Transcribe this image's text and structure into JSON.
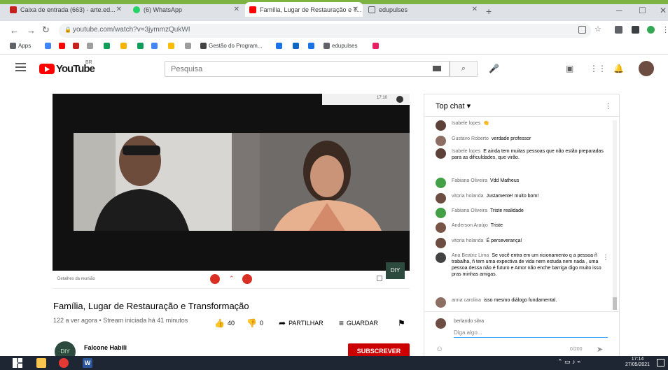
{
  "browser": {
    "tabs": [
      {
        "label": "Caixa de entrada (663) - arte.ed...",
        "color": "#c5221f",
        "active": false
      },
      {
        "label": "(6) WhatsApp",
        "color": "#25d366",
        "active": false
      },
      {
        "label": "Família, Lugar de Restauração e T...",
        "color": "#ff0000",
        "active": true
      },
      {
        "label": "edupulses",
        "color": "#5f6368",
        "active": false
      }
    ],
    "new_tab": "+",
    "url": "youtube.com/watch?v=3jymmzQukWI",
    "bookmarks": [
      {
        "label": "Apps",
        "color": "#5f6368"
      },
      {
        "label": "",
        "color": "#4285f4"
      },
      {
        "label": "",
        "color": "#ff0000"
      },
      {
        "label": "",
        "color": "#c5221f"
      },
      {
        "label": "",
        "color": "#9e9e9e"
      },
      {
        "label": "",
        "color": "#0f9d58"
      },
      {
        "label": "",
        "color": "#f4b400"
      },
      {
        "label": "",
        "color": "#0f9d58"
      },
      {
        "label": "",
        "color": "#4285f4"
      },
      {
        "label": "",
        "color": "#fbbc05"
      },
      {
        "label": "",
        "color": "#9e9e9e"
      },
      {
        "label": "Gestão do Program...",
        "color": "#424242"
      },
      {
        "label": "",
        "color": "#1a73e8"
      },
      {
        "label": "",
        "color": "#0a66c2"
      },
      {
        "label": "",
        "color": "#1a73e8"
      },
      {
        "label": "edupulses",
        "color": "#5f6368"
      },
      {
        "label": "",
        "color": "#e91e63"
      }
    ]
  },
  "youtube": {
    "wordmark": "YouTube",
    "country": "BR",
    "search_placeholder": "Pesquisa"
  },
  "video": {
    "title": "Família, Lugar de Restauração e Transformação",
    "meta": "122 a ver agora • Stream iniciada há 41 minutos",
    "likes": "40",
    "dislikes": "0",
    "share_label": "PARTILHAR",
    "save_label": "GUARDAR",
    "controls_text": "Detalhes da reunião",
    "player_time": "17:10",
    "corner_logo": "DIY",
    "channel_name": "Falcone Habili",
    "channel_avatar": "DIY",
    "subscribe_label": "SUBSCREVER"
  },
  "chat": {
    "mode": "Top chat",
    "messages": [
      {
        "author": "Isabele lopes",
        "text": "👏",
        "color": "#5d4037"
      },
      {
        "author": "Gustavo Roberto",
        "text": "verdade professor",
        "color": "#8d6e63"
      },
      {
        "author": "Isabele lopes",
        "text": "E ainda tem muitas pessoas que não estão preparadas para as dificuldades, que virão.",
        "color": "#5d4037"
      },
      {
        "author": "Fabiana Oliveira",
        "text": "Vdd Matheus",
        "color": "#43a047"
      },
      {
        "author": "vitoria holanda",
        "text": "Justamente! muito bom!",
        "color": "#6d4c41"
      },
      {
        "author": "Fabiana Oliveira",
        "text": "Triste realidade",
        "color": "#43a047"
      },
      {
        "author": "Anderson Araújo",
        "text": "Triste",
        "color": "#795548"
      },
      {
        "author": "vitoria holanda",
        "text": "É perseverança!",
        "color": "#6d4c41"
      },
      {
        "author": "Ana Beatriz Lima",
        "text": "Se você entra em um ricionamento q a pessoa ñ trabalha, ñ tem uma expectiva de vida nem estuda nem nada , uma pessoa dessa não é futuro e Amor não enche barriga digo muito isso pras minhas amigas.",
        "color": "#424242"
      },
      {
        "author": "anna carolina",
        "text": "isso mesmo diálogo fundamental.",
        "color": "#8d6e63"
      }
    ],
    "input_name": "berlando silva",
    "input_placeholder": "Diga algo...",
    "char_count": "0/200"
  },
  "taskbar": {
    "time": "17:14",
    "date": "27/05/2021"
  }
}
